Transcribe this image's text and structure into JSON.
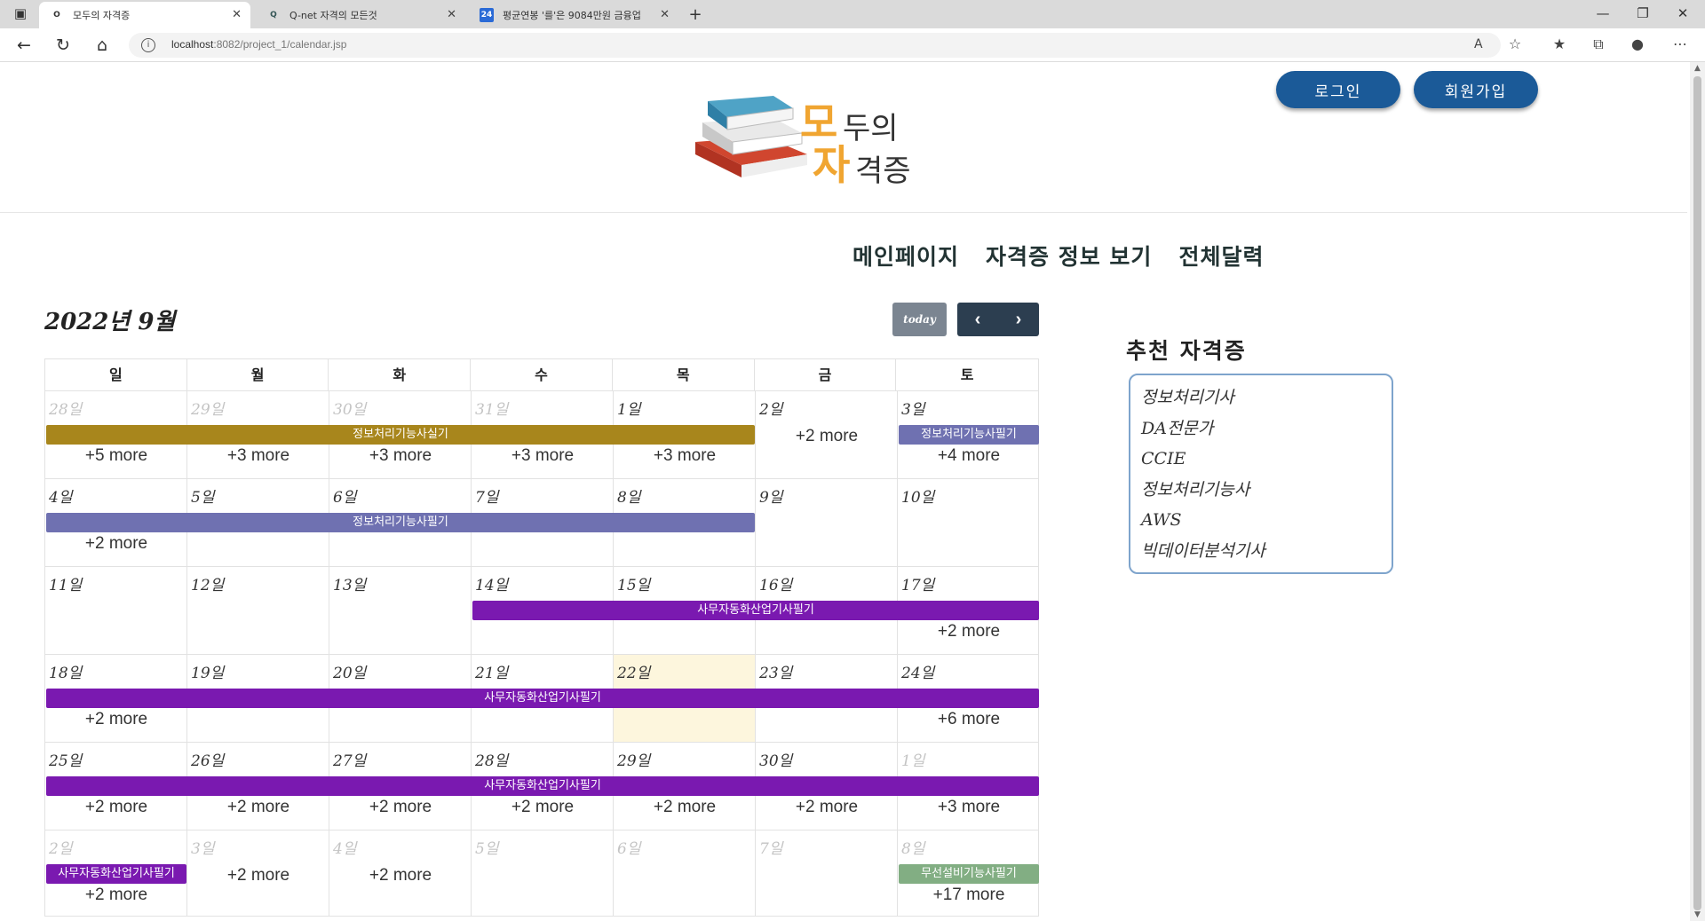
{
  "browser": {
    "tabs": [
      {
        "title": "모두의 자격증",
        "favicon": "O"
      },
      {
        "title": "Q-net 자격의 모든것",
        "favicon": "Q"
      },
      {
        "title": "평균연봉 '를'은 9084만원 금융업",
        "favicon": "24"
      }
    ],
    "url_host": "localhost",
    "url_path": ":8082/project_1/calendar.jsp"
  },
  "header": {
    "login_label": "로그인",
    "signup_label": "회원가입",
    "logo_text_line1": "모두의",
    "logo_text_line2": "자격증"
  },
  "nav": {
    "items": [
      "메인페이지",
      "자격증 정보 보기",
      "전체달력"
    ]
  },
  "calendar": {
    "title": "2022년 9월",
    "today_label": "today",
    "weekdays": [
      "일",
      "월",
      "화",
      "수",
      "목",
      "금",
      "토"
    ],
    "weeks": [
      {
        "days": [
          "28일",
          "29일",
          "30일",
          "31일",
          "1일",
          "2일",
          "3일"
        ],
        "other": [
          true,
          true,
          true,
          true,
          false,
          false,
          false
        ]
      },
      {
        "days": [
          "4일",
          "5일",
          "6일",
          "7일",
          "8일",
          "9일",
          "10일"
        ],
        "other": [
          false,
          false,
          false,
          false,
          false,
          false,
          false
        ]
      },
      {
        "days": [
          "11일",
          "12일",
          "13일",
          "14일",
          "15일",
          "16일",
          "17일"
        ],
        "other": [
          false,
          false,
          false,
          false,
          false,
          false,
          false
        ]
      },
      {
        "days": [
          "18일",
          "19일",
          "20일",
          "21일",
          "22일",
          "23일",
          "24일"
        ],
        "other": [
          false,
          false,
          false,
          false,
          false,
          false,
          false
        ]
      },
      {
        "days": [
          "25일",
          "26일",
          "27일",
          "28일",
          "29일",
          "30일",
          "1일"
        ],
        "other": [
          false,
          false,
          false,
          false,
          false,
          false,
          true
        ]
      },
      {
        "days": [
          "2일",
          "3일",
          "4일",
          "5일",
          "6일",
          "7일",
          "8일"
        ],
        "other": [
          true,
          true,
          true,
          true,
          true,
          true,
          true
        ]
      }
    ],
    "events": [
      {
        "week": 0,
        "start": 0,
        "span": 5,
        "label": "정보처리기능사실기",
        "color": "#a8861c"
      },
      {
        "week": 0,
        "start": 6,
        "span": 1,
        "label": "정보처리기능사필기",
        "color": "#6f71b1"
      },
      {
        "week": 1,
        "start": 0,
        "span": 5,
        "label": "정보처리기능사필기",
        "color": "#6f71b1"
      },
      {
        "week": 2,
        "start": 3,
        "span": 4,
        "label": "사무자동화산업기사필기",
        "color": "#7a19b0"
      },
      {
        "week": 3,
        "start": 0,
        "span": 7,
        "label": "사무자동화산업기사필기",
        "color": "#7a19b0"
      },
      {
        "week": 4,
        "start": 0,
        "span": 7,
        "label": "사무자동화산업기사필기",
        "color": "#7a19b0"
      },
      {
        "week": 5,
        "start": 0,
        "span": 1,
        "label": "사무자동화산업기사필기",
        "color": "#7a19b0"
      },
      {
        "week": 5,
        "start": 6,
        "span": 1,
        "label": "무선설비기능사필기",
        "color": "#82ae83"
      }
    ],
    "more": [
      {
        "week": 0,
        "day": 0,
        "text": "+5 more",
        "row": 2
      },
      {
        "week": 0,
        "day": 1,
        "text": "+3 more",
        "row": 2
      },
      {
        "week": 0,
        "day": 2,
        "text": "+3 more",
        "row": 2
      },
      {
        "week": 0,
        "day": 3,
        "text": "+3 more",
        "row": 2
      },
      {
        "week": 0,
        "day": 4,
        "text": "+3 more",
        "row": 2
      },
      {
        "week": 0,
        "day": 5,
        "text": "+2 more",
        "row": 1
      },
      {
        "week": 0,
        "day": 6,
        "text": "+4 more",
        "row": 2
      },
      {
        "week": 1,
        "day": 0,
        "text": "+2 more",
        "row": 2
      },
      {
        "week": 2,
        "day": 6,
        "text": "+2 more",
        "row": 2
      },
      {
        "week": 3,
        "day": 0,
        "text": "+2 more",
        "row": 2
      },
      {
        "week": 3,
        "day": 6,
        "text": "+6 more",
        "row": 2
      },
      {
        "week": 4,
        "day": 0,
        "text": "+2 more",
        "row": 2
      },
      {
        "week": 4,
        "day": 1,
        "text": "+2 more",
        "row": 2
      },
      {
        "week": 4,
        "day": 2,
        "text": "+2 more",
        "row": 2
      },
      {
        "week": 4,
        "day": 3,
        "text": "+2 more",
        "row": 2
      },
      {
        "week": 4,
        "day": 4,
        "text": "+2 more",
        "row": 2
      },
      {
        "week": 4,
        "day": 5,
        "text": "+2 more",
        "row": 2
      },
      {
        "week": 4,
        "day": 6,
        "text": "+3 more",
        "row": 2
      },
      {
        "week": 5,
        "day": 0,
        "text": "+2 more",
        "row": 2
      },
      {
        "week": 5,
        "day": 1,
        "text": "+2 more",
        "row": 1
      },
      {
        "week": 5,
        "day": 2,
        "text": "+2 more",
        "row": 1
      },
      {
        "week": 5,
        "day": 6,
        "text": "+17 more",
        "row": 2
      }
    ],
    "today": {
      "week": 3,
      "day": 4
    }
  },
  "sidebar": {
    "title": "추천 자격증",
    "items": [
      "정보처리기사",
      "DA전문가",
      "CCIE",
      "정보처리기능사",
      "AWS",
      "빅데이터분석기사"
    ]
  }
}
